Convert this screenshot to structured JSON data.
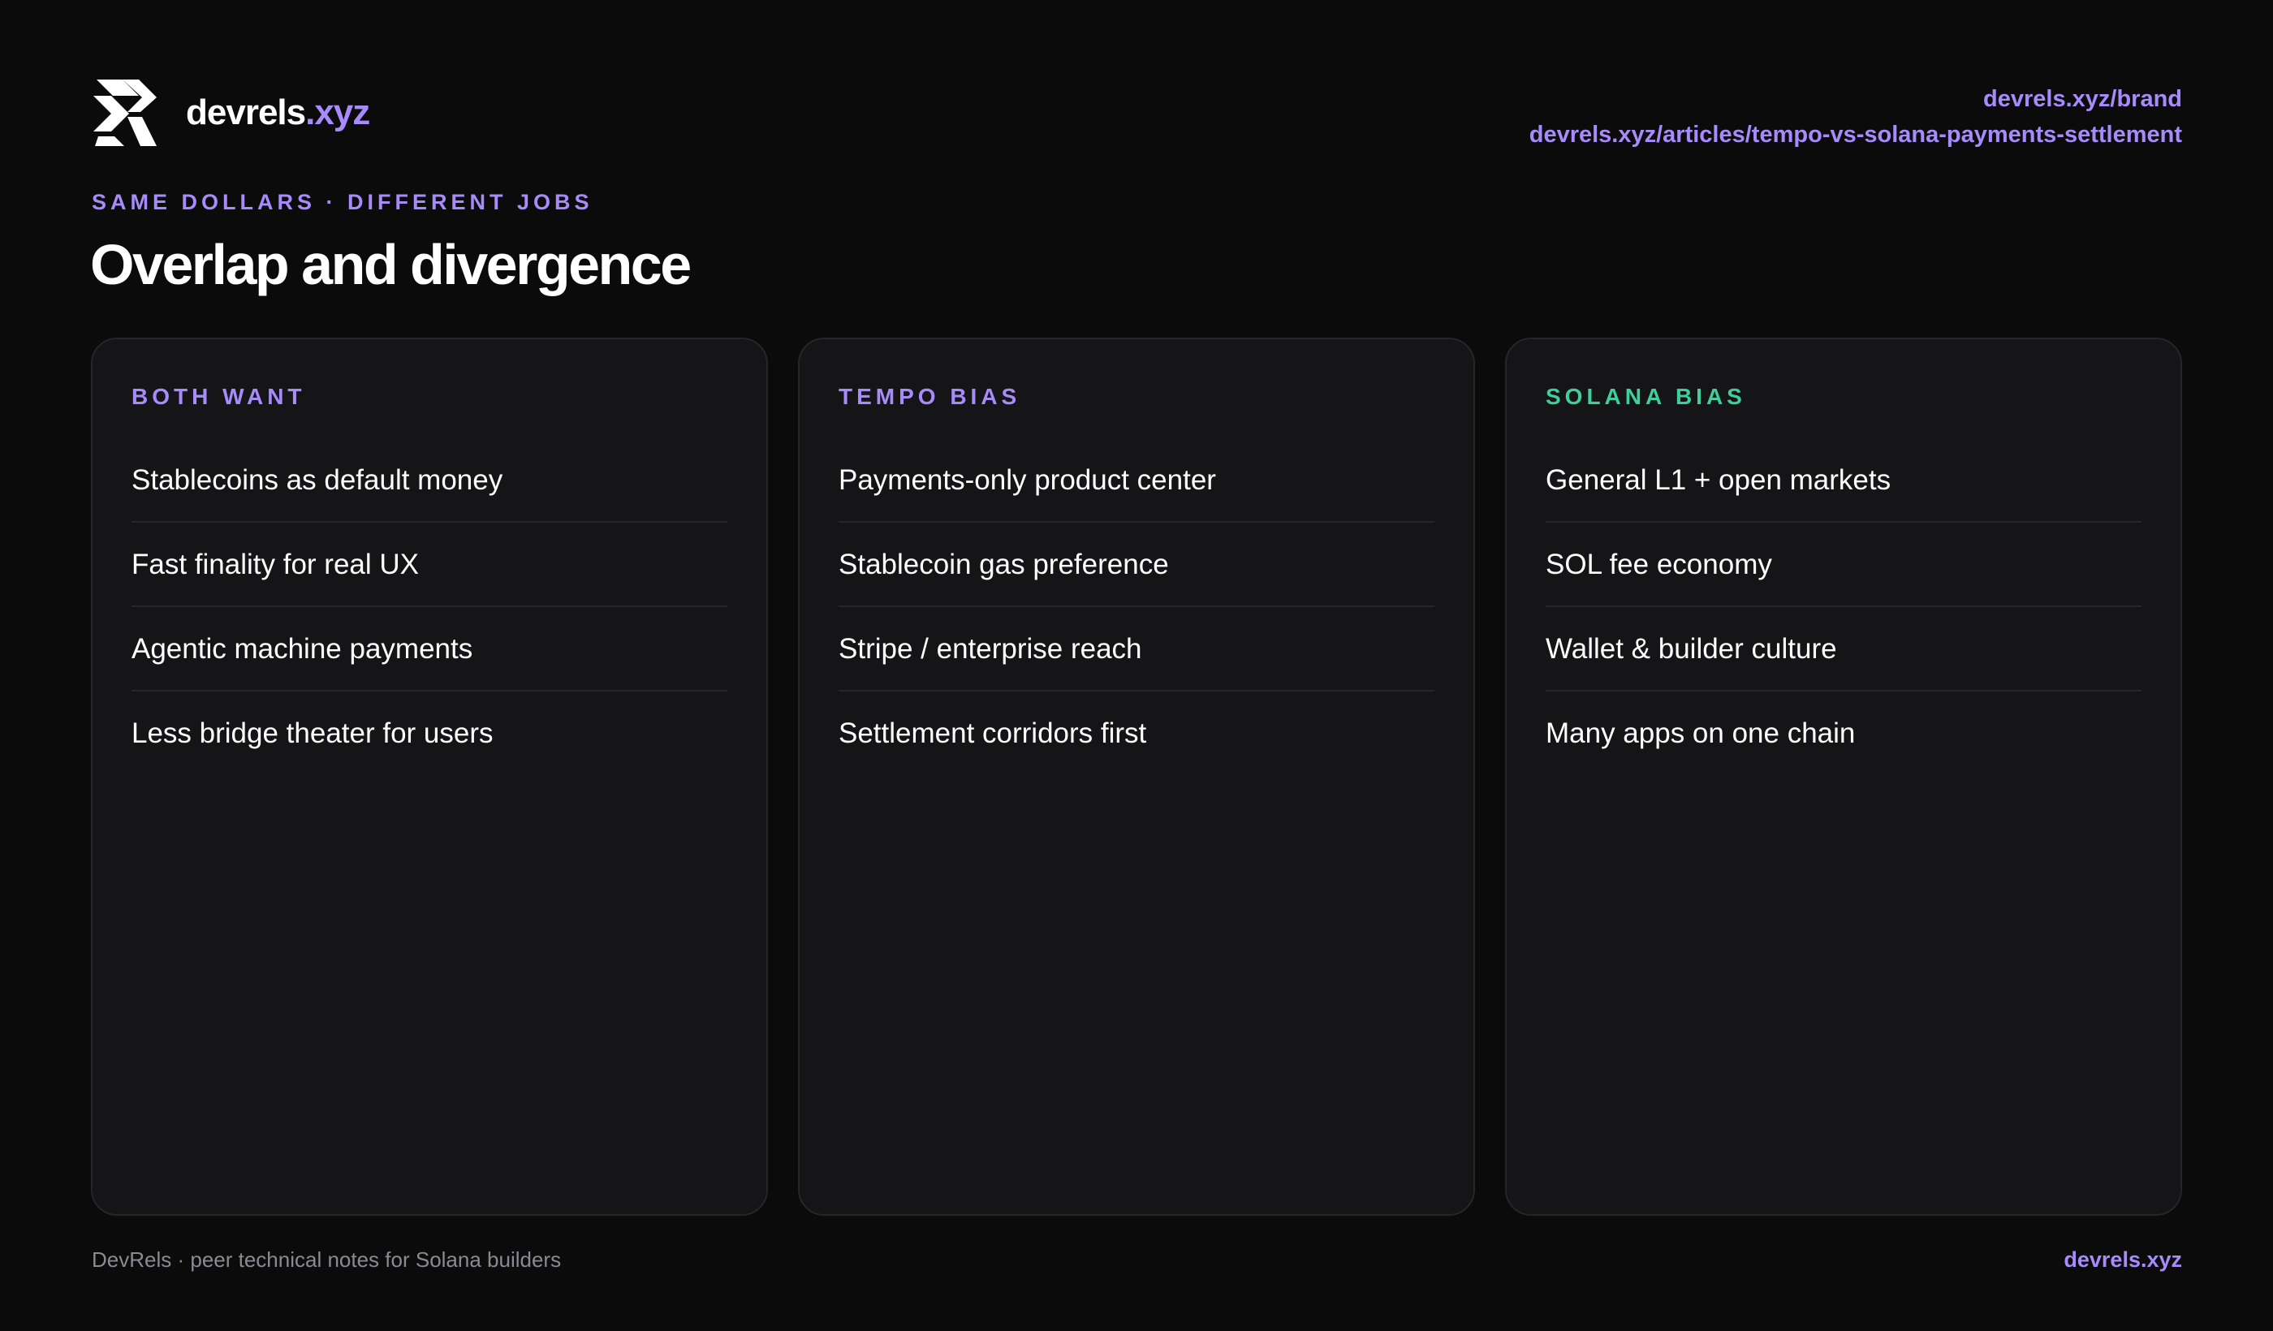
{
  "header": {
    "logo_icon": "devrels-logo-icon",
    "brand_base": "devrels",
    "brand_tld": ".xyz",
    "links": [
      "devrels.xyz/brand",
      "devrels.xyz/articles/tempo-vs-solana-payments-settlement"
    ]
  },
  "eyebrow": "SAME DOLLARS · DIFFERENT JOBS",
  "title": "Overlap and divergence",
  "cards": [
    {
      "heading": "BOTH WANT",
      "items": [
        "Stablecoins as default money",
        "Fast finality for real UX",
        "Agentic machine payments",
        "Less bridge theater for users"
      ]
    },
    {
      "heading": "TEMPO BIAS",
      "items": [
        "Payments-only product center",
        "Stablecoin gas preference",
        "Stripe / enterprise reach",
        "Settlement corridors first"
      ]
    },
    {
      "heading": "SOLANA BIAS",
      "items": [
        "General L1 + open markets",
        "SOL fee economy",
        "Wallet & builder culture",
        "Many apps on one chain"
      ]
    }
  ],
  "footer": {
    "tagline": "DevRels · peer technical notes for Solana builders",
    "site": "devrels.xyz"
  },
  "colors": {
    "background": "#0b0b0c",
    "card": "#151517",
    "accent_purple": "#a78bfa",
    "accent_green": "#3ecf9a",
    "muted_text": "#8a8a93"
  }
}
